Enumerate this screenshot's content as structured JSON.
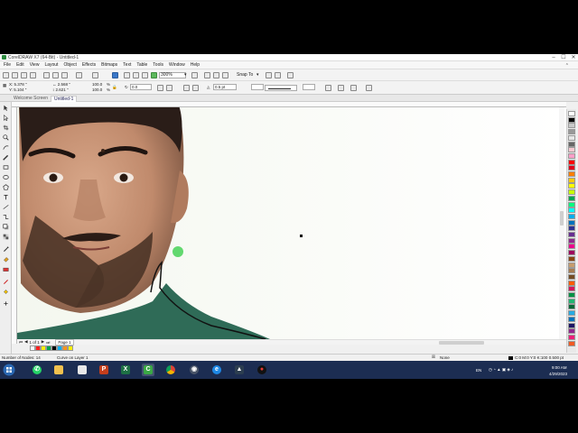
{
  "window": {
    "title": "CorelDRAW X7 (64-Bit) - Untitled-1",
    "min_glyph": "–",
    "max_glyph": "☐",
    "close_glyph": "✕"
  },
  "menubar": {
    "items": [
      "File",
      "Edit",
      "View",
      "Layout",
      "Object",
      "Effects",
      "Bitmaps",
      "Text",
      "Table",
      "Tools",
      "Window",
      "Help"
    ],
    "right_label": "⌃"
  },
  "toolbar": {
    "zoom": "300%",
    "snap_to": "Snap To",
    "zoom_arrow": "▾",
    "snap_arrow": "▾"
  },
  "propbar": {
    "x": "X: 5.378 \"",
    "y": "Y: 5.104 \"",
    "w": "↔ 2.568 \"",
    "h": "↕ 2.621 \"",
    "sx": "100.0",
    "sy": "100.0",
    "pct1": "%",
    "pct2": "%",
    "angle": "0.0",
    "outline_width": "0.5 pt"
  },
  "tabs": {
    "welcome": "Welcome Screen",
    "document": "Untitled-1"
  },
  "pagenav": {
    "first": "⏮",
    "prev": "◀",
    "page_of": "1 of 1",
    "next": "▶",
    "last": "⏭",
    "page_name": "Page 1"
  },
  "status": {
    "nodes": "Number of Nodes: 14",
    "curve": "Curve on Layer 1",
    "fill": "None",
    "outline": "C:0 M:0 Y:0 K:100  0.500 pt"
  },
  "tray": {
    "lang": "EN",
    "time": "9:00 AM",
    "date": "4/29/2023"
  },
  "colors": {
    "accent": "#3a78c9",
    "node_marker": "#62d86f",
    "taskbar": "#1c2d52",
    "shirt": "#2f6b57"
  },
  "icons": {
    "start": "windows-logo-icon",
    "taskbar_apps": [
      "whatsapp-icon",
      "file-explorer-icon",
      "files-icon",
      "powerpoint-icon",
      "excel-icon",
      "coreldraw-icon",
      "chrome-icon",
      "media-icon",
      "edge-icon",
      "app-icon",
      "record-icon"
    ]
  }
}
